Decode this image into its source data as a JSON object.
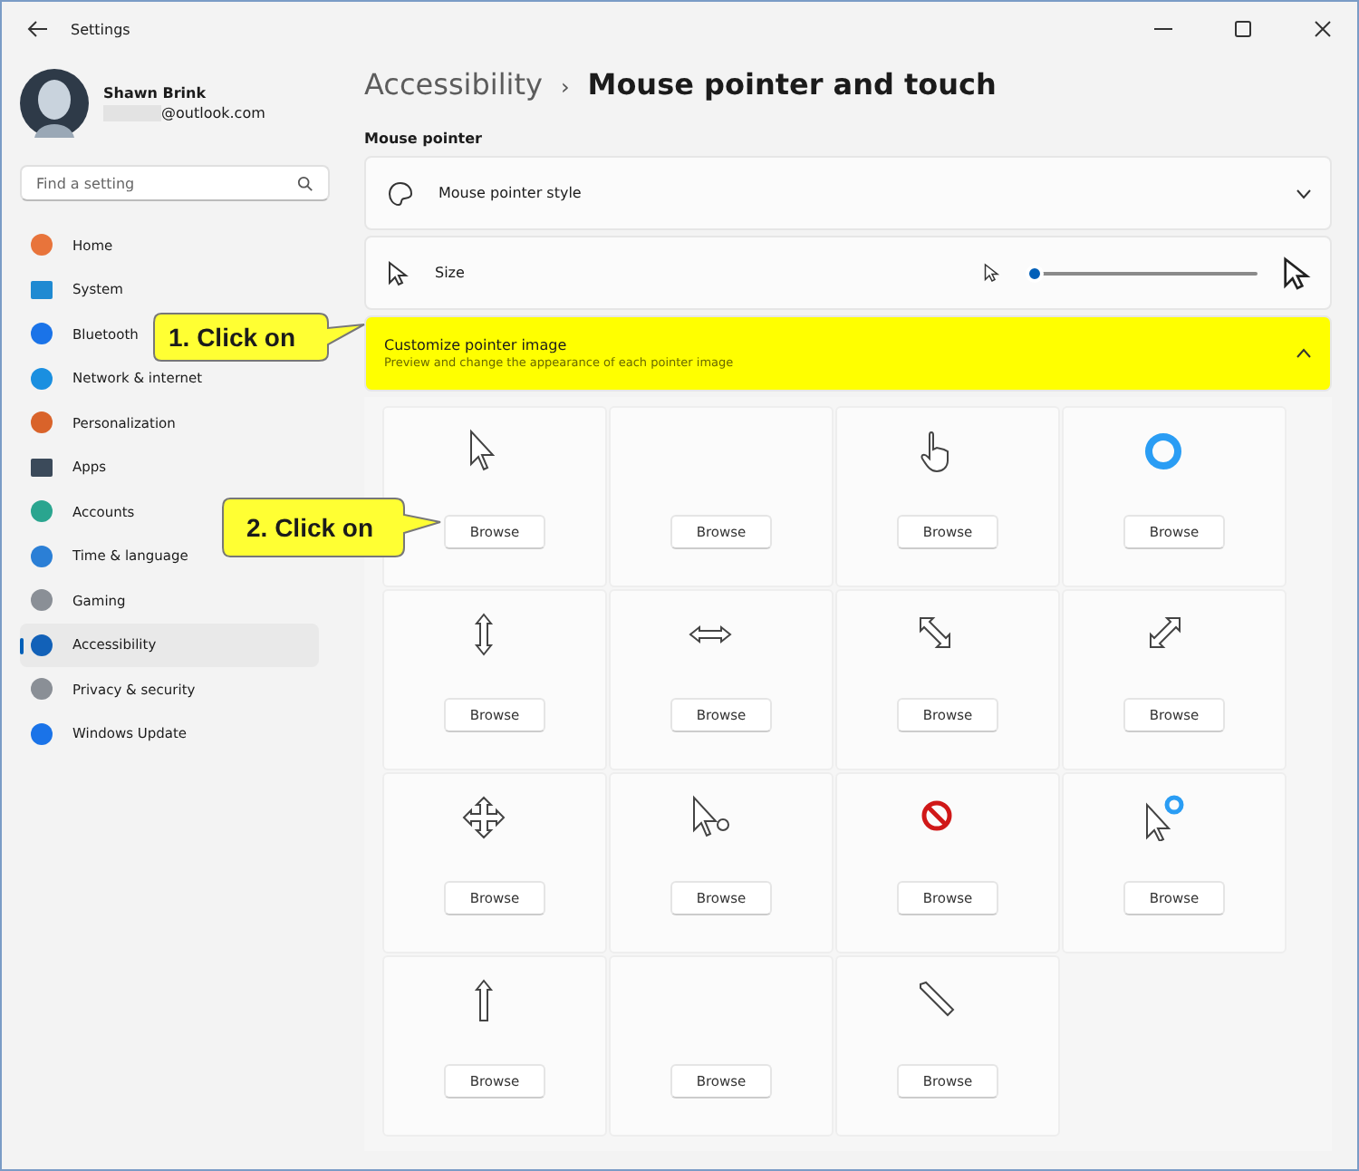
{
  "window": {
    "title": "Settings"
  },
  "profile": {
    "name": "Shawn Brink",
    "email": "@outlook.com"
  },
  "search": {
    "placeholder": "Find a setting"
  },
  "sidebar": {
    "items": [
      {
        "label": "Home",
        "selected": false
      },
      {
        "label": "System",
        "selected": false
      },
      {
        "label": "Bluetooth",
        "selected": false
      },
      {
        "label": "Network & internet",
        "selected": false
      },
      {
        "label": "Personalization",
        "selected": false
      },
      {
        "label": "Apps",
        "selected": false
      },
      {
        "label": "Accounts",
        "selected": false
      },
      {
        "label": "Time & language",
        "selected": false
      },
      {
        "label": "Gaming",
        "selected": false
      },
      {
        "label": "Accessibility",
        "selected": true
      },
      {
        "label": "Privacy & security",
        "selected": false
      },
      {
        "label": "Windows Update",
        "selected": false
      }
    ]
  },
  "breadcrumb": {
    "parent": "Accessibility",
    "separator": "›",
    "current": "Mouse pointer and touch"
  },
  "section_title": "Mouse pointer",
  "cards": [
    {
      "kind": "expander",
      "label": "Mouse pointer style",
      "expanded": false
    },
    {
      "kind": "slider",
      "label": "Size",
      "level": 0.0
    },
    {
      "kind": "expander",
      "label": "Customize pointer image",
      "description": "Preview and change the appearance of each pointer image",
      "expanded": true,
      "highlighted": true
    }
  ],
  "pointer_tiles": [
    {
      "kind": "arrow",
      "button": "Browse"
    },
    {
      "kind": "none",
      "button": "Browse"
    },
    {
      "kind": "hand",
      "button": "Browse"
    },
    {
      "kind": "busy",
      "button": "Browse"
    },
    {
      "kind": "vertical",
      "button": "Browse"
    },
    {
      "kind": "horizontal",
      "button": "Browse"
    },
    {
      "kind": "diagonal1",
      "button": "Browse"
    },
    {
      "kind": "diagonal2",
      "button": "Browse"
    },
    {
      "kind": "move",
      "button": "Browse"
    },
    {
      "kind": "help",
      "button": "Browse"
    },
    {
      "kind": "unavailable",
      "button": "Browse"
    },
    {
      "kind": "working",
      "button": "Browse"
    },
    {
      "kind": "alternate",
      "button": "Browse"
    },
    {
      "kind": "none",
      "button": "Browse"
    },
    {
      "kind": "pen",
      "button": "Browse"
    }
  ],
  "callouts": [
    {
      "text": "1. Click on"
    },
    {
      "text": "2. Click on"
    }
  ]
}
